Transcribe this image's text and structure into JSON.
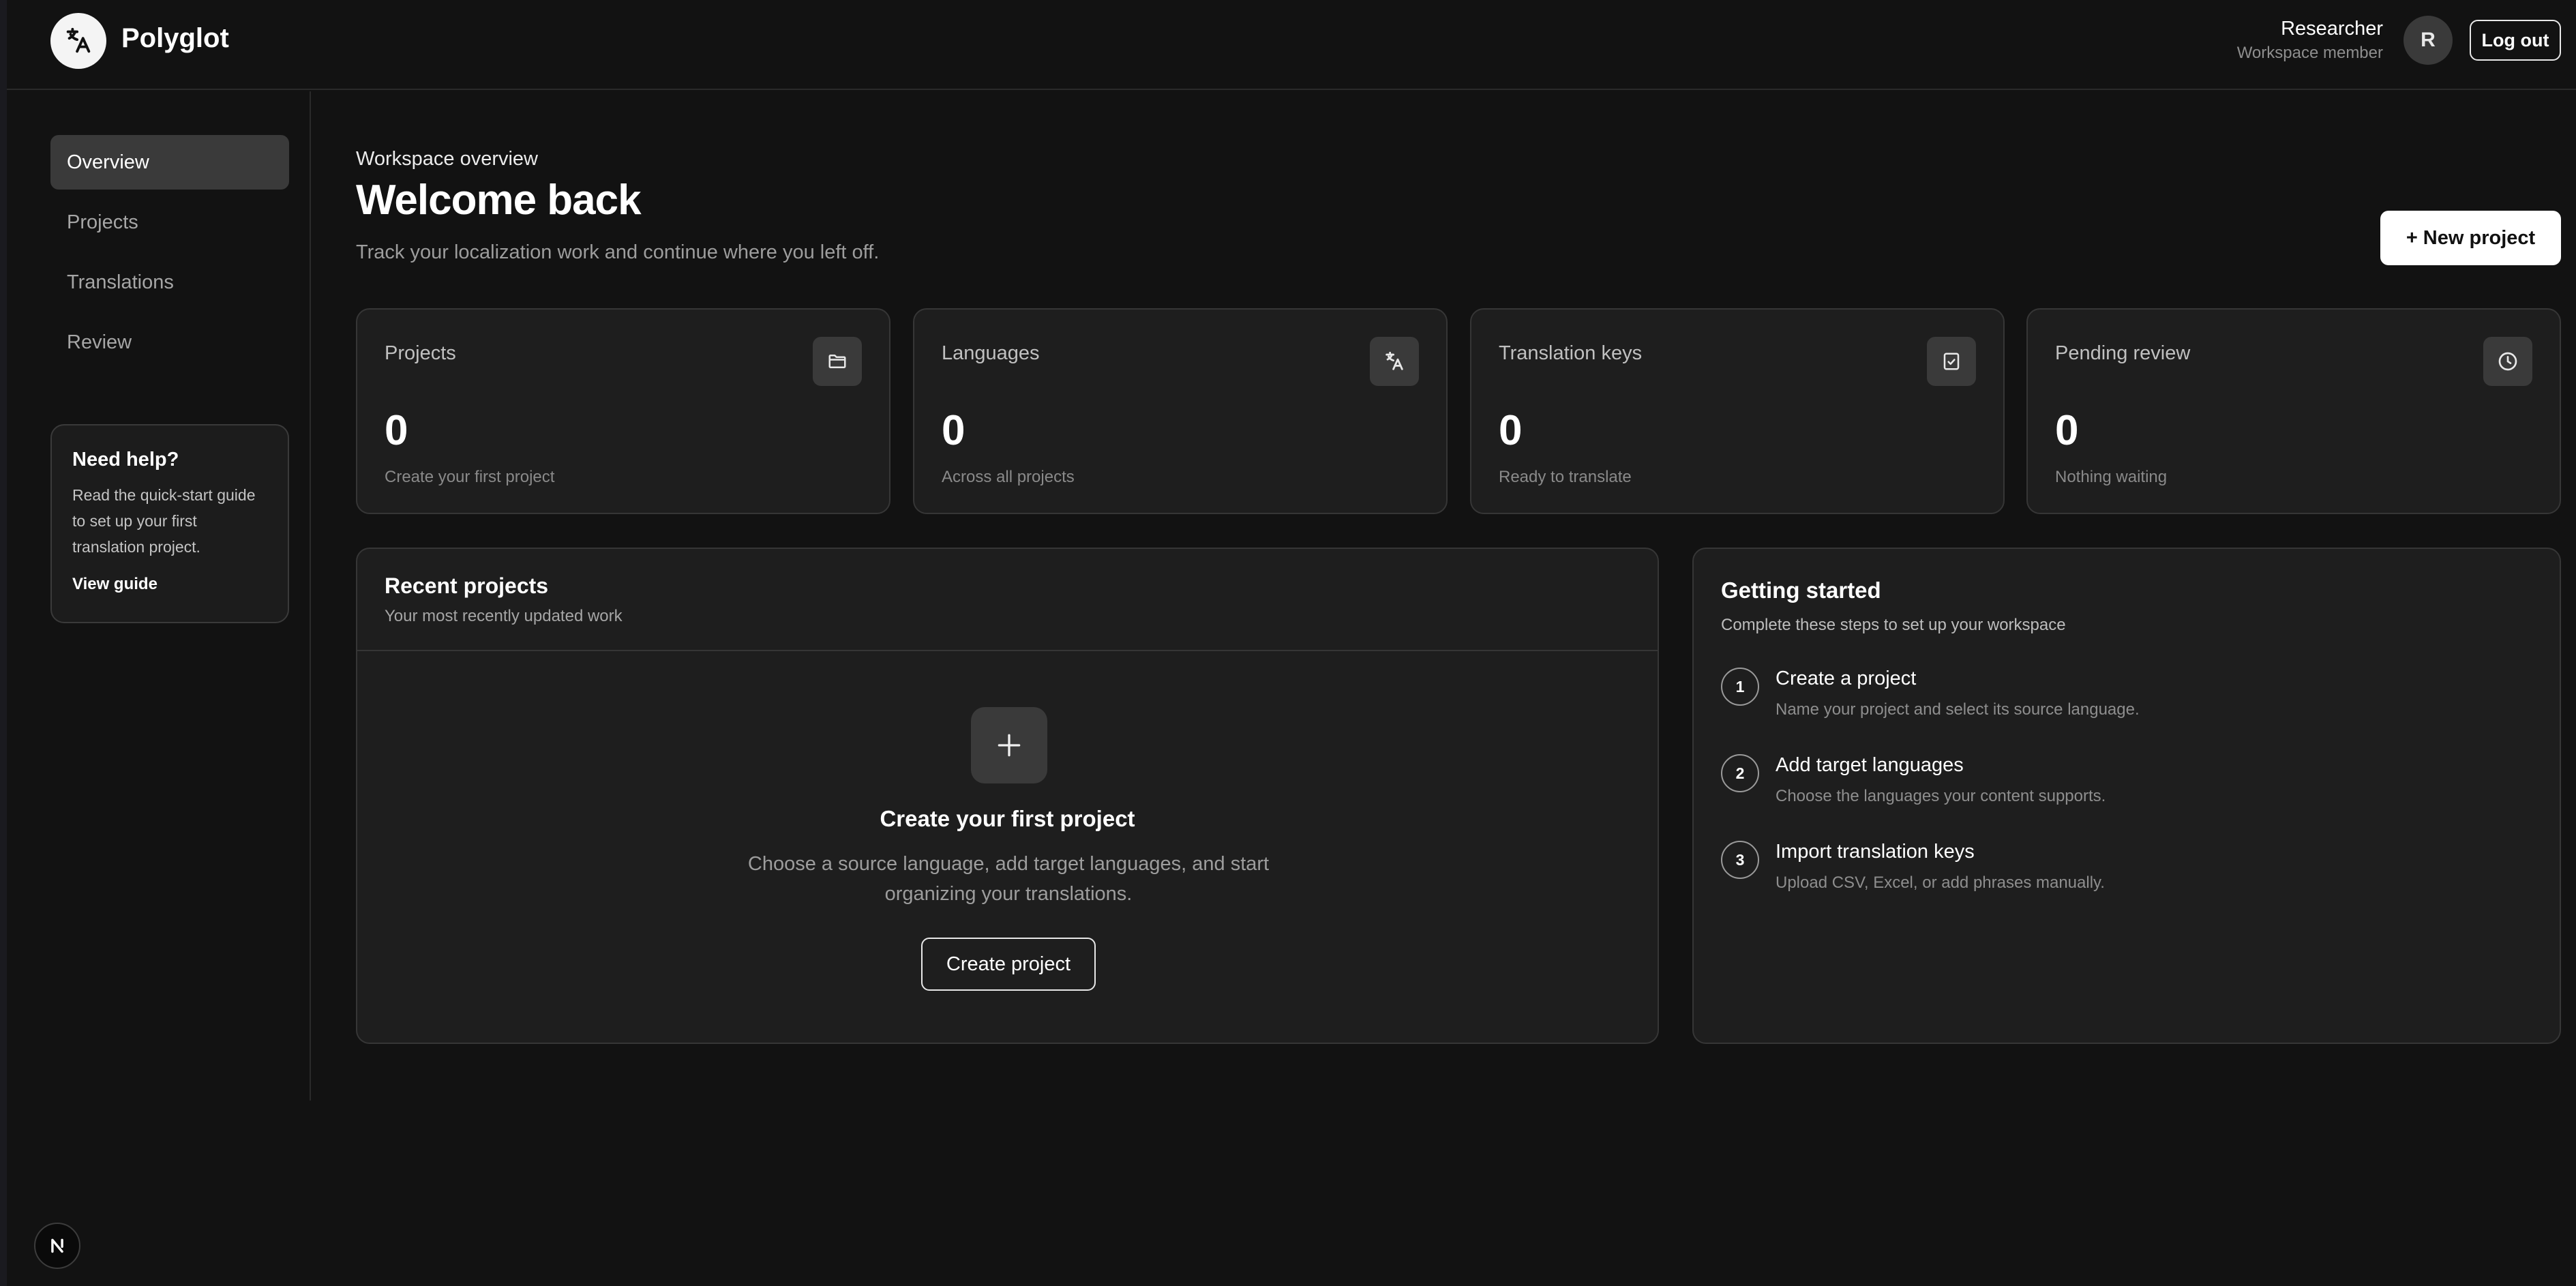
{
  "header": {
    "brand": "Polyglot",
    "user_name": "Researcher",
    "user_role": "Workspace member",
    "avatar_initial": "R",
    "logout_label": "Log out"
  },
  "sidebar": {
    "items": [
      {
        "label": "Overview",
        "active": true
      },
      {
        "label": "Projects",
        "active": false
      },
      {
        "label": "Translations",
        "active": false
      },
      {
        "label": "Review",
        "active": false
      }
    ],
    "help": {
      "title": "Need help?",
      "body": "Read the quick-start guide to set up your first translation project.",
      "link": "View guide"
    }
  },
  "main": {
    "eyebrow": "Workspace overview",
    "title": "Welcome back",
    "subtitle": "Track your localization work and continue where you left off.",
    "new_project_label": "+ New project"
  },
  "stats": [
    {
      "label": "Projects",
      "value": "0",
      "note": "Create your first project",
      "icon": "folder-icon"
    },
    {
      "label": "Languages",
      "value": "0",
      "note": "Across all projects",
      "icon": "translate-icon"
    },
    {
      "label": "Translation keys",
      "value": "0",
      "note": "Ready to translate",
      "icon": "checkbox-icon"
    },
    {
      "label": "Pending review",
      "value": "0",
      "note": "Nothing waiting",
      "icon": "clock-icon"
    }
  ],
  "recent": {
    "title": "Recent projects",
    "subtitle": "Your most recently updated work",
    "empty_title": "Create your first project",
    "empty_desc": "Choose a source language, add target languages, and start organizing your translations.",
    "create_label": "Create project"
  },
  "getting_started": {
    "title": "Getting started",
    "subtitle": "Complete these steps to set up your workspace",
    "steps": [
      {
        "num": "1",
        "title": "Create a project",
        "desc": "Name your project and select its source language."
      },
      {
        "num": "2",
        "title": "Add target languages",
        "desc": "Choose the languages your content supports."
      },
      {
        "num": "3",
        "title": "Import translation keys",
        "desc": "Upload CSV, Excel, or add phrases manually."
      }
    ]
  },
  "colors": {
    "background": "#121212",
    "card": "#1e1e1e",
    "border": "#363636",
    "accent": "#ffffff",
    "muted_text": "#8e8e8e"
  }
}
